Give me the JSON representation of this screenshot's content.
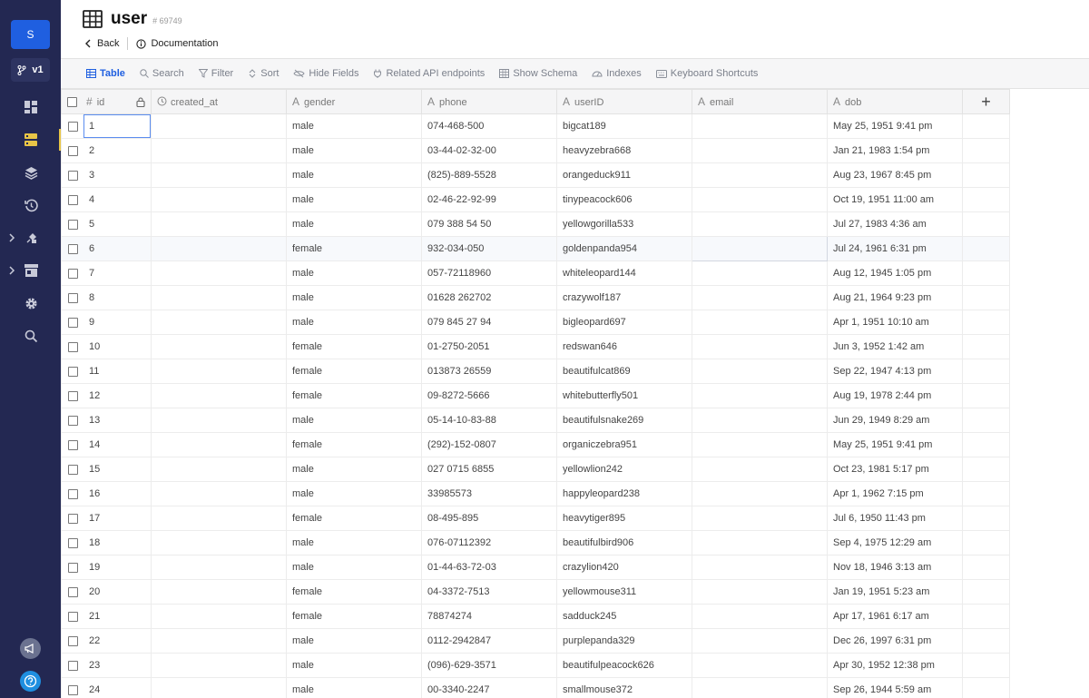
{
  "sidebar": {
    "avatar_letter": "S",
    "version_label": "v1",
    "accent": "#e8c547"
  },
  "header": {
    "title": "user",
    "table_id": "# 69749",
    "back_label": "Back",
    "doc_label": "Documentation"
  },
  "toolbar": {
    "table": "Table",
    "search": "Search",
    "filter": "Filter",
    "sort": "Sort",
    "hide_fields": "Hide Fields",
    "api": "Related API endpoints",
    "schema": "Show Schema",
    "indexes": "Indexes",
    "shortcuts": "Keyboard Shortcuts"
  },
  "columns": {
    "id": "id",
    "created_at": "created_at",
    "gender": "gender",
    "phone": "phone",
    "userID": "userID",
    "email": "email",
    "dob": "dob",
    "add": "+"
  },
  "rows": [
    {
      "id": "1",
      "gender": "male",
      "phone": "074-468-500",
      "userID": "bigcat189",
      "dob": "May 25, 1951 9:41 pm"
    },
    {
      "id": "2",
      "gender": "male",
      "phone": "03-44-02-32-00",
      "userID": "heavyzebra668",
      "dob": "Jan 21, 1983 1:54 pm"
    },
    {
      "id": "3",
      "gender": "male",
      "phone": "(825)-889-5528",
      "userID": "orangeduck911",
      "dob": "Aug 23, 1967 8:45 pm"
    },
    {
      "id": "4",
      "gender": "male",
      "phone": "02-46-22-92-99",
      "userID": "tinypeacock606",
      "dob": "Oct 19, 1951 11:00 am"
    },
    {
      "id": "5",
      "gender": "male",
      "phone": "079 388 54 50",
      "userID": "yellowgorilla533",
      "dob": "Jul 27, 1983 4:36 am"
    },
    {
      "id": "6",
      "gender": "female",
      "phone": "932-034-050",
      "userID": "goldenpanda954",
      "dob": "Jul 24, 1961 6:31 pm"
    },
    {
      "id": "7",
      "gender": "male",
      "phone": "057-72118960",
      "userID": "whiteleopard144",
      "dob": "Aug 12, 1945 1:05 pm"
    },
    {
      "id": "8",
      "gender": "male",
      "phone": "01628 262702",
      "userID": "crazywolf187",
      "dob": "Aug 21, 1964 9:23 pm"
    },
    {
      "id": "9",
      "gender": "male",
      "phone": "079 845 27 94",
      "userID": "bigleopard697",
      "dob": "Apr 1, 1951 10:10 am"
    },
    {
      "id": "10",
      "gender": "female",
      "phone": "01-2750-2051",
      "userID": "redswan646",
      "dob": "Jun 3, 1952 1:42 am"
    },
    {
      "id": "11",
      "gender": "female",
      "phone": "013873 26559",
      "userID": "beautifulcat869",
      "dob": "Sep 22, 1947 4:13 pm"
    },
    {
      "id": "12",
      "gender": "female",
      "phone": "09-8272-5666",
      "userID": "whitebutterfly501",
      "dob": "Aug 19, 1978 2:44 pm"
    },
    {
      "id": "13",
      "gender": "male",
      "phone": "05-14-10-83-88",
      "userID": "beautifulsnake269",
      "dob": "Jun 29, 1949 8:29 am"
    },
    {
      "id": "14",
      "gender": "female",
      "phone": "(292)-152-0807",
      "userID": "organiczebra951",
      "dob": "May 25, 1951 9:41 pm"
    },
    {
      "id": "15",
      "gender": "male",
      "phone": "027 0715 6855",
      "userID": "yellowlion242",
      "dob": "Oct 23, 1981 5:17 pm"
    },
    {
      "id": "16",
      "gender": "male",
      "phone": "33985573",
      "userID": "happyleopard238",
      "dob": "Apr 1, 1962 7:15 pm"
    },
    {
      "id": "17",
      "gender": "female",
      "phone": "08-495-895",
      "userID": "heavytiger895",
      "dob": "Jul 6, 1950 11:43 pm"
    },
    {
      "id": "18",
      "gender": "male",
      "phone": "076-07112392",
      "userID": "beautifulbird906",
      "dob": "Sep 4, 1975 12:29 am"
    },
    {
      "id": "19",
      "gender": "male",
      "phone": "01-44-63-72-03",
      "userID": "crazylion420",
      "dob": "Nov 18, 1946 3:13 am"
    },
    {
      "id": "20",
      "gender": "female",
      "phone": "04-3372-7513",
      "userID": "yellowmouse311",
      "dob": "Jan 19, 1951 5:23 am"
    },
    {
      "id": "21",
      "gender": "female",
      "phone": "78874274",
      "userID": "sadduck245",
      "dob": "Apr 17, 1961 6:17 am"
    },
    {
      "id": "22",
      "gender": "male",
      "phone": "0112-2942847",
      "userID": "purplepanda329",
      "dob": "Dec 26, 1997 6:31 pm"
    },
    {
      "id": "23",
      "gender": "male",
      "phone": "(096)-629-3571",
      "userID": "beautifulpeacock626",
      "dob": "Apr 30, 1952 12:38 pm"
    },
    {
      "id": "24",
      "gender": "male",
      "phone": "00-3340-2247",
      "userID": "smallmouse372",
      "dob": "Sep 26, 1944 5:59 am"
    }
  ]
}
